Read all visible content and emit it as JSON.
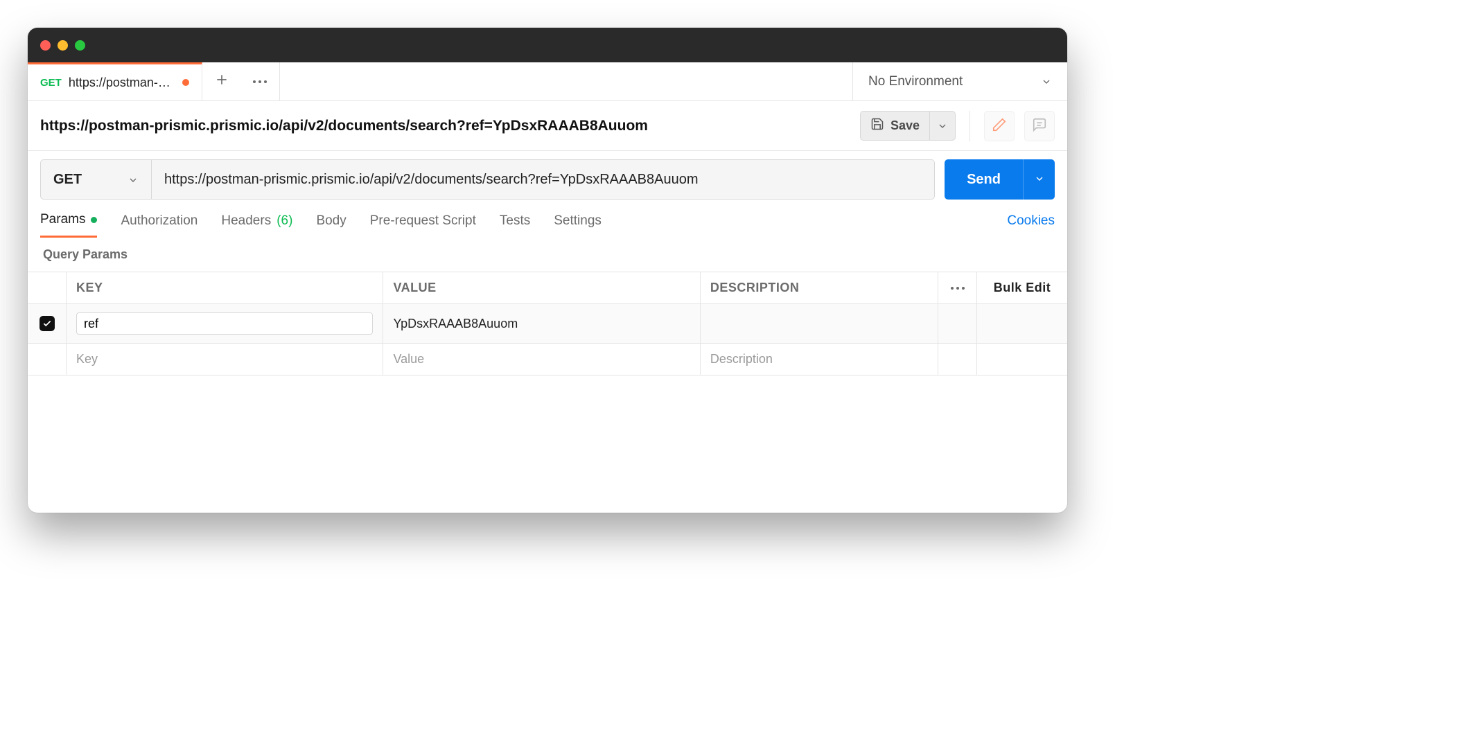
{
  "tab": {
    "method": "GET",
    "label": "https://postman-prism"
  },
  "environment": {
    "label": "No Environment"
  },
  "request": {
    "name": "https://postman-prismic.prismic.io/api/v2/documents/search?ref=YpDsxRAAAB8Auuom",
    "save_label": "Save",
    "method": "GET",
    "url": "https://postman-prismic.prismic.io/api/v2/documents/search?ref=YpDsxRAAAB8Auuom",
    "send_label": "Send"
  },
  "subtabs": {
    "params": "Params",
    "authorization": "Authorization",
    "headers": "Headers",
    "headers_count": "(6)",
    "body": "Body",
    "prerequest": "Pre-request Script",
    "tests": "Tests",
    "settings": "Settings",
    "cookies": "Cookies"
  },
  "params_section": {
    "title": "Query Params",
    "headers": {
      "key": "KEY",
      "value": "VALUE",
      "description": "DESCRIPTION",
      "bulk_edit": "Bulk Edit"
    },
    "rows": [
      {
        "enabled": true,
        "key": "ref",
        "value": "YpDsxRAAAB8Auuom",
        "description": ""
      }
    ],
    "placeholders": {
      "key": "Key",
      "value": "Value",
      "description": "Description"
    }
  }
}
